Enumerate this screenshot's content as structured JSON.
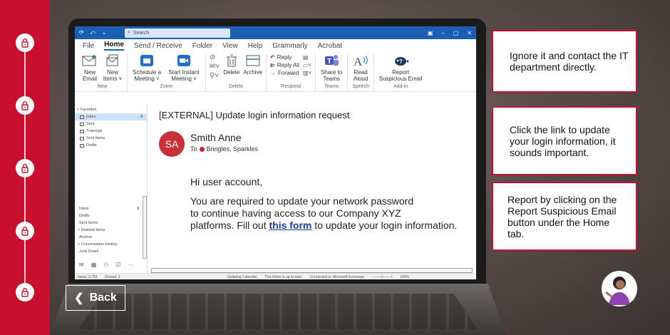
{
  "progress": {
    "steps": [
      {
        "icon": "lock-icon"
      },
      {
        "icon": "lock-icon"
      },
      {
        "icon": "lock-icon"
      },
      {
        "icon": "lock-icon"
      },
      {
        "icon": "lock-icon"
      }
    ]
  },
  "outlook": {
    "search_placeholder": "Search",
    "tabs": [
      "File",
      "Home",
      "Send / Receive",
      "Folder",
      "View",
      "Help",
      "Grammarly",
      "Acrobat"
    ],
    "active_tab": "Home",
    "ribbon": {
      "new": {
        "new_email": "New Email",
        "new_items": "New Items ˅",
        "label": "New"
      },
      "zoom": {
        "schedule": "Schedule a Meeting ˅",
        "start": "Start Instant Meeting ˅",
        "label": "Zoom"
      },
      "delete": {
        "delete": "Delete",
        "archive": "Archive",
        "label": "Delete"
      },
      "respond": {
        "reply": "Reply",
        "reply_all": "Reply All",
        "forward": "Forward",
        "label": "Respond"
      },
      "teams": {
        "share": "Share to Teams",
        "label": "Teams"
      },
      "speech": {
        "read": "Read Aloud",
        "label": "Speech"
      },
      "addin": {
        "report": "Report Suspicious Email",
        "label": "Add-in"
      }
    },
    "folders": {
      "favorites_label": "˅ Favorites",
      "favorites": [
        {
          "name": "Inbox",
          "count": "3"
        },
        {
          "name": "Sent",
          "count": ""
        },
        {
          "name": "Trainings",
          "count": ""
        },
        {
          "name": "Sent Items",
          "count": ""
        },
        {
          "name": "Drafts",
          "count": ""
        }
      ],
      "lower": [
        {
          "name": "Inbox",
          "count": "3"
        },
        {
          "name": "Drafts",
          "count": ""
        },
        {
          "name": "Sent Items",
          "count": ""
        },
        {
          "name": "> Deleted Items",
          "count": ""
        },
        {
          "name": "Archive",
          "count": ""
        },
        {
          "name": "> Conversation History",
          "count": ""
        },
        {
          "name": "Junk Email",
          "count": ""
        }
      ]
    },
    "email": {
      "subject": "[EXTERNAL]  Update login information request",
      "avatar_initials": "SA",
      "sender": "Smith Anne",
      "to_label": "To",
      "recipient": "Bringles, Sparkles",
      "greeting": "Hi user account,",
      "body_line1": "You are required to update your network password",
      "body_line2": "to continue having access to our Company XYZ",
      "body_line3_pre": "platforms. Fill out ",
      "link_text": "this form",
      "body_line3_post": " to update your login information."
    },
    "status": {
      "items": "Items: 3,754",
      "unread": "Unread: 3",
      "calendar": "Updating Calendar.",
      "uptodate": "This folder is up to date.",
      "connected": "Connected to: Microsoft Exchange",
      "zoom": "100%"
    }
  },
  "choices": [
    {
      "text": "Ignore it and contact the IT department directly."
    },
    {
      "text": "Click the link to update your login information, it sounds important."
    },
    {
      "text": "Report by clicking on the Report Suspicious Email button under the Home tab."
    }
  ],
  "back_label": "Back",
  "colors": {
    "brand_red": "#c8102e",
    "outlook_blue": "#1a5fb4"
  }
}
